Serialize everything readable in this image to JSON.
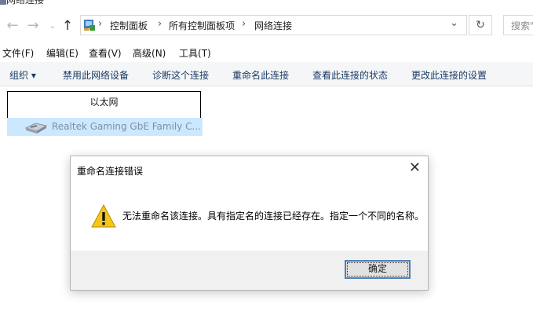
{
  "window": {
    "title": "网络连接"
  },
  "nav": {
    "back_icon": "back-arrow-icon",
    "forward_icon": "forward-arrow-icon",
    "recent_icon": "chevron-down-icon",
    "up_icon": "up-arrow-icon"
  },
  "address": {
    "crumbs": [
      "控制面板",
      "所有控制面板项",
      "网络连接"
    ],
    "separator": "›"
  },
  "search": {
    "placeholder": "搜索\""
  },
  "menubar": {
    "items": [
      {
        "label": "文件",
        "key": "(F)"
      },
      {
        "label": "编辑",
        "key": "(E)"
      },
      {
        "label": "查看",
        "key": "(V)"
      },
      {
        "label": "高级",
        "key": "(N)"
      },
      {
        "label": "工具",
        "key": "(T)"
      }
    ]
  },
  "commandbar": {
    "organize": "组织 ▾",
    "items": [
      "禁用此网络设备",
      "诊断这个连接",
      "重命名此连接",
      "查看此连接的状态",
      "更改此连接的设置"
    ]
  },
  "connection": {
    "rename_value": "以太网",
    "adapter": "Realtek Gaming GbE Family C..."
  },
  "dialog": {
    "title": "重命名连接错误",
    "close_glyph": "✕",
    "message": "无法重命名该连接。具有指定名的连接已经存在。指定一个不同的名称。",
    "ok_label": "确定",
    "icon": "warning-icon"
  },
  "colors": {
    "selection": "#cce8ff",
    "command_text": "#1a3b66",
    "warning": "#f5c518",
    "default_button_border": "#4e80bb"
  }
}
